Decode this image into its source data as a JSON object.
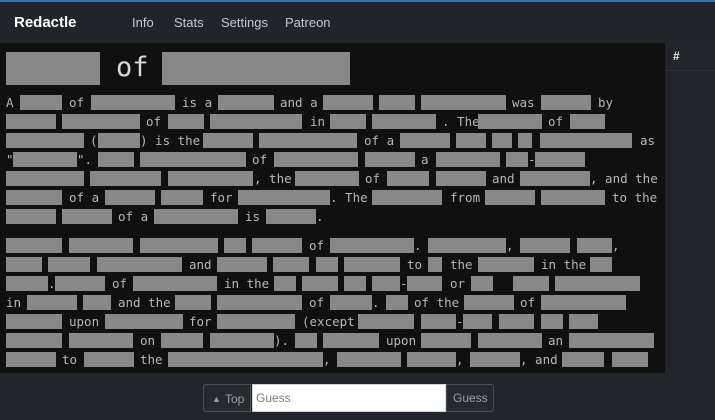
{
  "nav": {
    "brand": "Redactle",
    "links": [
      "Info",
      "Stats",
      "Settings",
      "Patreon"
    ]
  },
  "article": {
    "title_word": "of",
    "words": [
      "A",
      "of",
      "is a",
      "and a",
      "was",
      "by",
      "of",
      "in",
      ". The",
      "of",
      "(",
      ") is the",
      "of a",
      "as",
      "\"",
      "\".",
      "of",
      "a",
      "-",
      ", the",
      "of",
      "and",
      ", and the",
      "of a",
      "for",
      ". The",
      "from",
      "to the",
      "of a",
      "is",
      ".",
      "of",
      ".",
      ",",
      ",",
      "and",
      "to",
      "the",
      "in the",
      ".",
      "of",
      "in the",
      "-",
      "or",
      "in",
      "and the",
      "of",
      ".",
      "of the",
      "of",
      "upon",
      "for",
      "(except",
      "-",
      "on",
      ").",
      "upon",
      "an",
      "to",
      "the",
      ",",
      ",",
      ", and"
    ]
  },
  "sidebar": {
    "header": "#"
  },
  "bottom": {
    "top_label": "Top",
    "guess_placeholder": "Guess",
    "guess_button": "Guess"
  },
  "colors": {
    "accent": "#3b6fb4",
    "redaction": "#888888",
    "article_bg": "#101010",
    "navbar_bg": "#212529"
  }
}
